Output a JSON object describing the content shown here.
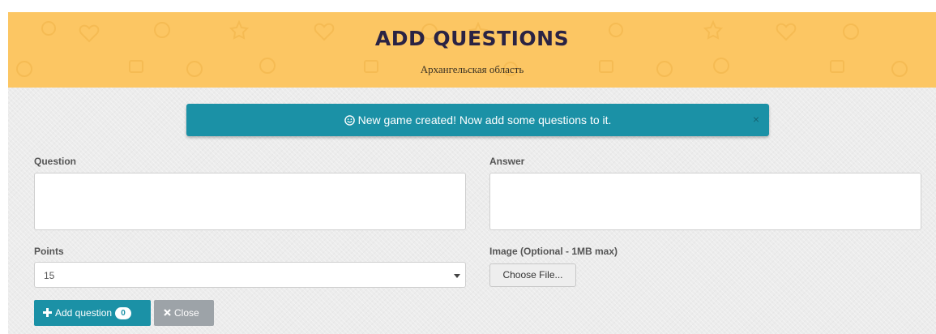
{
  "header": {
    "title": "Add Questions",
    "subtitle": "Архангельская область"
  },
  "alert": {
    "message": "New game created! Now add some questions to it.",
    "close_glyph": "×",
    "icon": "smiley-icon"
  },
  "form": {
    "question_label": "Question",
    "question_value": "",
    "answer_label": "Answer",
    "answer_value": "",
    "points_label": "Points",
    "points_value": "15",
    "image_label": "Image (Optional - 1MB max)",
    "file_button_label": "Choose File..."
  },
  "buttons": {
    "add_label": "Add question",
    "add_count": "0",
    "close_label": "Close"
  },
  "colors": {
    "header_bg": "#fcc663",
    "accent": "#1b91a6",
    "close_button": "#9da3a8",
    "title_text": "#2a2344"
  }
}
